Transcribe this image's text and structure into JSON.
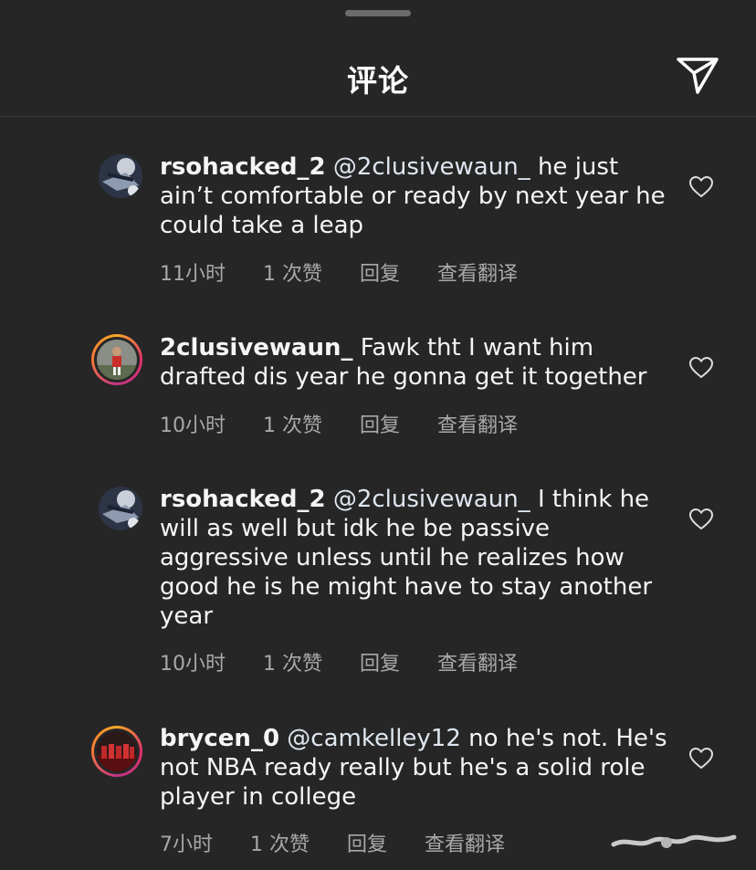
{
  "header": {
    "title": "评论",
    "share_icon": "send-icon"
  },
  "comments": [
    {
      "username": "rsohacked_2",
      "mention": "@2clusivewaun_",
      "text": "he just ain’t comfortable or ready by next year he could take a leap",
      "time": "11小时",
      "likes": "1 次赞",
      "reply": "回复",
      "translate": "查看翻译"
    },
    {
      "username": "2clusivewaun_",
      "mention": "",
      "text": "Fawk tht I want him drafted dis year he gonna get it together",
      "time": "10小时",
      "likes": "1 次赞",
      "reply": "回复",
      "translate": "查看翻译"
    },
    {
      "username": "rsohacked_2",
      "mention": "@2clusivewaun_",
      "text": "I think he will as well but idk he be passive aggressive unless until he realizes how good he is he might have to stay another year",
      "time": "10小时",
      "likes": "1 次赞",
      "reply": "回复",
      "translate": "查看翻译"
    },
    {
      "username": "brycen_0",
      "mention": "@camkelley12",
      "text": "no he's not. He's not NBA ready really but he's a solid role player in college",
      "time": "7小时",
      "likes": "1 次赞",
      "reply": "回复",
      "translate": "查看翻译"
    }
  ],
  "colors": {
    "background": "#262626",
    "meta": "#a8a8a8",
    "text": "#f5f5f5"
  }
}
